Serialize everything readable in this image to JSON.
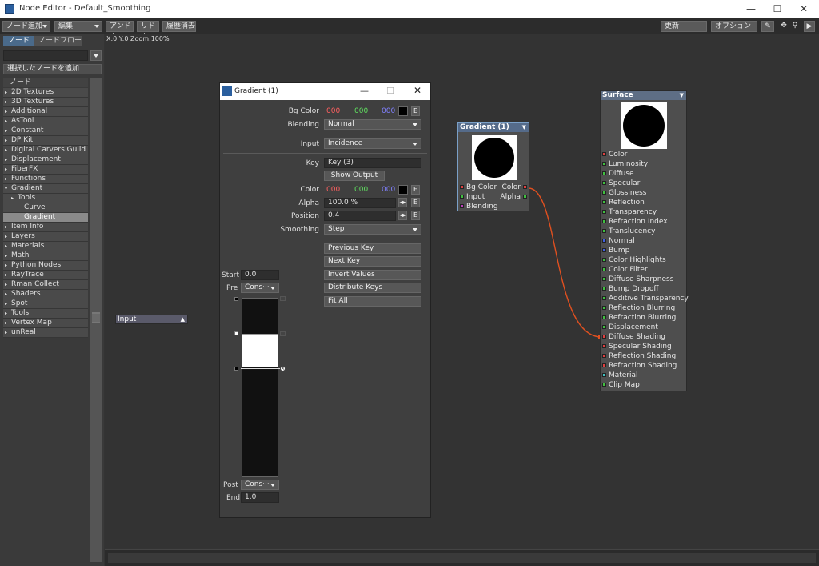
{
  "window": {
    "title": "Node Editor - Default_Smoothing",
    "minimize": "—",
    "maximize": "☐",
    "close": "✕"
  },
  "toolbar": {
    "add_node": "ノード追加",
    "edit": "編集",
    "undo": "アンドゥ",
    "redo": "リドゥ",
    "clear_history": "履歴消去",
    "update": "更新",
    "options": "オプション"
  },
  "left": {
    "tab_nodes": "ノード",
    "tab_nodeflow": "ノードフロー",
    "add_selected": "選択したノードを追加",
    "list_header": "ノード",
    "items": [
      {
        "label": "2D Textures",
        "tri": "▸",
        "indent": 0,
        "selected": false
      },
      {
        "label": "3D Textures",
        "tri": "▸",
        "indent": 0,
        "selected": false
      },
      {
        "label": "Additional",
        "tri": "▸",
        "indent": 0,
        "selected": false
      },
      {
        "label": "AsTool",
        "tri": "▸",
        "indent": 0,
        "selected": false
      },
      {
        "label": "Constant",
        "tri": "▸",
        "indent": 0,
        "selected": false
      },
      {
        "label": "DP Kit",
        "tri": "▸",
        "indent": 0,
        "selected": false
      },
      {
        "label": "Digital Carvers Guild",
        "tri": "▸",
        "indent": 0,
        "selected": false
      },
      {
        "label": "Displacement",
        "tri": "▸",
        "indent": 0,
        "selected": false
      },
      {
        "label": "FiberFX",
        "tri": "▸",
        "indent": 0,
        "selected": false
      },
      {
        "label": "Functions",
        "tri": "▸",
        "indent": 0,
        "selected": false
      },
      {
        "label": "Gradient",
        "tri": "▾",
        "indent": 0,
        "selected": false
      },
      {
        "label": "Tools",
        "tri": "▸",
        "indent": 1,
        "selected": false
      },
      {
        "label": "Curve",
        "tri": "",
        "indent": 2,
        "selected": false
      },
      {
        "label": "Gradient",
        "tri": "",
        "indent": 2,
        "selected": true
      },
      {
        "label": "Item Info",
        "tri": "▸",
        "indent": 0,
        "selected": false
      },
      {
        "label": "Layers",
        "tri": "▸",
        "indent": 0,
        "selected": false
      },
      {
        "label": "Materials",
        "tri": "▸",
        "indent": 0,
        "selected": false
      },
      {
        "label": "Math",
        "tri": "▸",
        "indent": 0,
        "selected": false
      },
      {
        "label": "Python Nodes",
        "tri": "▸",
        "indent": 0,
        "selected": false
      },
      {
        "label": "RayTrace",
        "tri": "▸",
        "indent": 0,
        "selected": false
      },
      {
        "label": "Rman Collect",
        "tri": "▸",
        "indent": 0,
        "selected": false
      },
      {
        "label": "Shaders",
        "tri": "▸",
        "indent": 0,
        "selected": false
      },
      {
        "label": "Spot",
        "tri": "▸",
        "indent": 0,
        "selected": false
      },
      {
        "label": "Tools",
        "tri": "▸",
        "indent": 0,
        "selected": false
      },
      {
        "label": "Vertex Map",
        "tri": "▸",
        "indent": 0,
        "selected": false
      },
      {
        "label": "unReal",
        "tri": "▸",
        "indent": 0,
        "selected": false
      }
    ]
  },
  "canvas": {
    "status": "X:0 Y:0 Zoom:100%",
    "input_node": "Input"
  },
  "gradient_node": {
    "title": "Gradient (1)",
    "inputs": [
      {
        "label": "Bg Color",
        "color": "#e04040"
      },
      {
        "label": "Input",
        "color": "#40c040"
      },
      {
        "label": "Blending",
        "color": "#c040c0"
      }
    ],
    "outputs": [
      {
        "label": "Color",
        "color": "#e04040"
      },
      {
        "label": "Alpha",
        "color": "#40c040"
      }
    ]
  },
  "surface_node": {
    "title": "Surface",
    "inputs": [
      {
        "label": "Color",
        "color": "#e04040"
      },
      {
        "label": "Luminosity",
        "color": "#40c040"
      },
      {
        "label": "Diffuse",
        "color": "#40c040"
      },
      {
        "label": "Specular",
        "color": "#40c040"
      },
      {
        "label": "Glossiness",
        "color": "#40c040"
      },
      {
        "label": "Reflection",
        "color": "#40c040"
      },
      {
        "label": "Transparency",
        "color": "#40c040"
      },
      {
        "label": "Refraction Index",
        "color": "#40c040"
      },
      {
        "label": "Translucency",
        "color": "#40c040"
      },
      {
        "label": "Normal",
        "color": "#4060e0"
      },
      {
        "label": "Bump",
        "color": "#4060e0"
      },
      {
        "label": "Color Highlights",
        "color": "#40c040"
      },
      {
        "label": "Color Filter",
        "color": "#40c040"
      },
      {
        "label": "Diffuse Sharpness",
        "color": "#40c040"
      },
      {
        "label": "Bump Dropoff",
        "color": "#40c040"
      },
      {
        "label": "Additive Transparency",
        "color": "#40c040"
      },
      {
        "label": "Reflection Blurring",
        "color": "#40c040"
      },
      {
        "label": "Refraction Blurring",
        "color": "#40c040"
      },
      {
        "label": "Displacement",
        "color": "#40c040"
      },
      {
        "label": "Diffuse Shading",
        "color": "#e04040"
      },
      {
        "label": "Specular Shading",
        "color": "#e04040"
      },
      {
        "label": "Reflection Shading",
        "color": "#e04040"
      },
      {
        "label": "Refraction Shading",
        "color": "#e04040"
      },
      {
        "label": "Material",
        "color": "#40c0c0"
      },
      {
        "label": "Clip Map",
        "color": "#40c040"
      }
    ]
  },
  "dialog": {
    "title": "Gradient (1)",
    "bg_color_label": "Bg Color",
    "bg_r": "000",
    "bg_g": "000",
    "bg_b": "000",
    "blending_label": "Blending",
    "blending_value": "Normal",
    "input_label": "Input",
    "input_value": "Incidence",
    "key_label": "Key",
    "key_value": "Key (3)",
    "show_output": "Show Output",
    "color_label": "Color",
    "c_r": "000",
    "c_g": "000",
    "c_b": "000",
    "alpha_label": "Alpha",
    "alpha_value": "100.0 %",
    "position_label": "Position",
    "position_value": "0.4",
    "smoothing_label": "Smoothing",
    "smoothing_value": "Step",
    "e": "E",
    "previous_key": "Previous Key",
    "next_key": "Next Key",
    "invert_values": "Invert Values",
    "distribute_keys": "Distribute Keys",
    "fit_all": "Fit All",
    "start_label": "Start",
    "start_value": "0.0",
    "pre_label": "Pre",
    "pre_value": "Cons···",
    "post_label": "Post",
    "post_value": "Cons···",
    "end_label": "End",
    "end_value": "1.0"
  }
}
